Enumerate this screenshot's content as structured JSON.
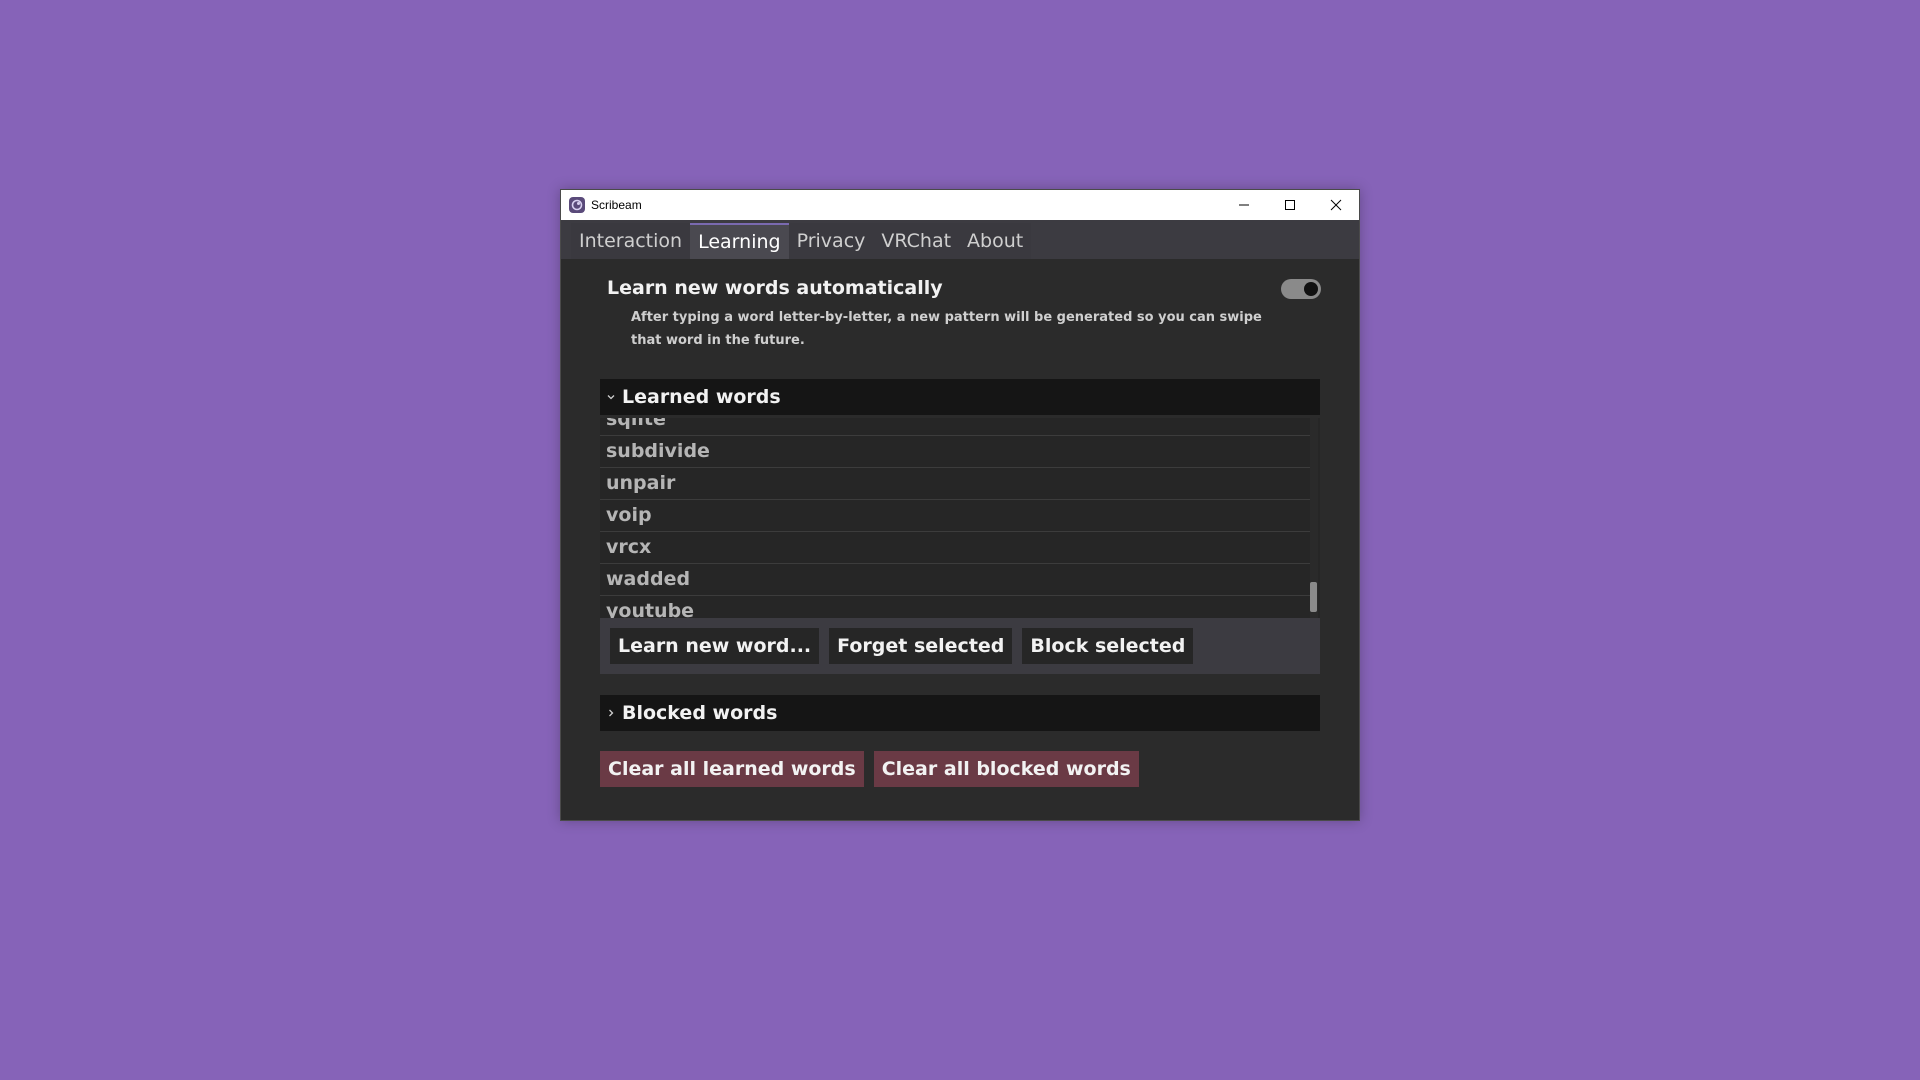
{
  "window": {
    "title": "Scribeam"
  },
  "tabs": [
    {
      "label": "Interaction",
      "active": false
    },
    {
      "label": "Learning",
      "active": true
    },
    {
      "label": "Privacy",
      "active": false
    },
    {
      "label": "VRChat",
      "active": false
    },
    {
      "label": "About",
      "active": false
    }
  ],
  "learning": {
    "auto_learn_label": "Learn new words automatically",
    "auto_learn_enabled": true,
    "description": "After typing a word letter-by-letter, a new pattern will be generated so you can swipe that word in the future.",
    "learned_section": {
      "title": "Learned words",
      "expanded": true,
      "items": [
        "sqlite",
        "subdivide",
        "unpair",
        "voip",
        "vrcx",
        "wadded",
        "youtube"
      ]
    },
    "actions": {
      "learn_new": "Learn new word...",
      "forget": "Forget selected",
      "block": "Block selected"
    },
    "blocked_section": {
      "title": "Blocked words",
      "expanded": false
    },
    "danger": {
      "clear_learned": "Clear all learned words",
      "clear_blocked": "Clear all blocked words"
    }
  },
  "colors": {
    "desktop": "#8663b8",
    "window_bg": "#2b2b2b",
    "danger_button": "#6a3a45"
  }
}
